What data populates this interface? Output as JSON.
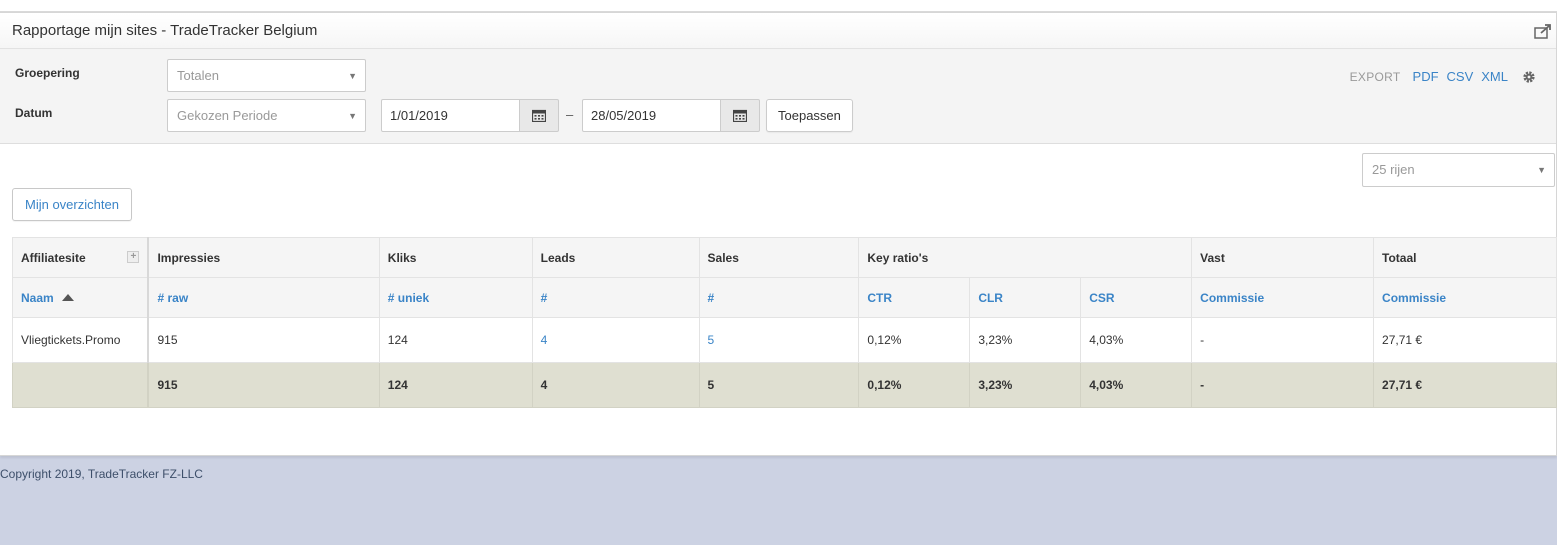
{
  "header": {
    "title": "Rapportage mijn sites - TradeTracker Belgium"
  },
  "filters": {
    "grouping_label": "Groepering",
    "grouping_value": "Totalen",
    "date_label": "Datum",
    "period_value": "Gekozen Periode",
    "date_from": "1/01/2019",
    "date_sep": "–",
    "date_to": "28/05/2019",
    "apply_label": "Toepassen"
  },
  "export": {
    "label": "EXPORT",
    "pdf": "PDF",
    "csv": "CSV",
    "xml": "XML"
  },
  "rows_select": "25 rijen",
  "overview_button": "Mijn overzichten",
  "table": {
    "group_headers": [
      "Affiliatesite",
      "Impressies",
      "Kliks",
      "Leads",
      "Sales",
      "Key ratio's",
      "Vast",
      "Totaal"
    ],
    "sub_headers": [
      "Naam",
      "# raw",
      "# uniek",
      "#",
      "#",
      "CTR",
      "CLR",
      "CSR",
      "Commissie",
      "Commissie"
    ],
    "rows": [
      [
        "Vliegtickets.Promo",
        "915",
        "124",
        "4",
        "5",
        "0,12%",
        "3,23%",
        "4,03%",
        "-",
        "27,71 €"
      ]
    ],
    "totals": [
      "",
      "915",
      "124",
      "4",
      "5",
      "0,12%",
      "3,23%",
      "4,03%",
      "-",
      "27,71 €"
    ]
  },
  "footer": {
    "copyright": "Copyright 2019, TradeTracker FZ-LLC"
  },
  "colors": {
    "link": "#3a84c7",
    "total_row": "#dfdfd1",
    "page_bg": "#ccd2e3"
  }
}
